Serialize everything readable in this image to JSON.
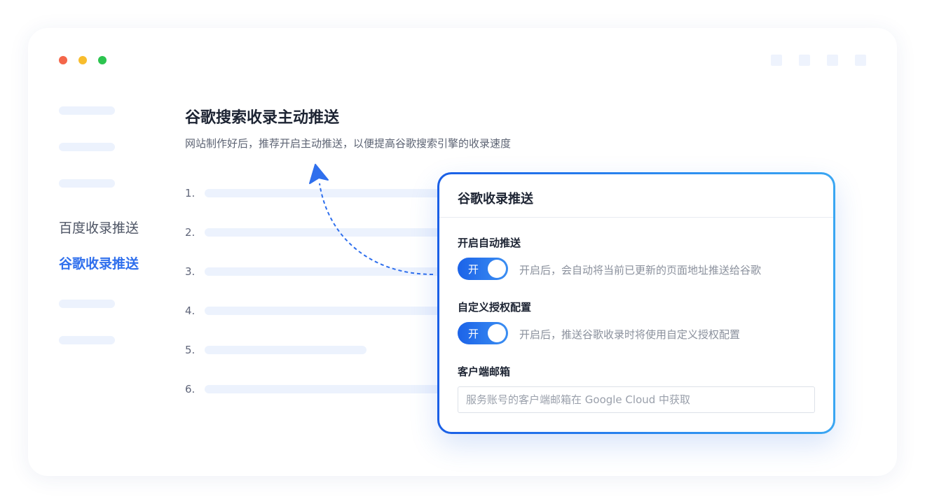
{
  "sidebar": {
    "items": [
      {
        "label": "百度收录推送",
        "active": false
      },
      {
        "label": "谷歌收录推送",
        "active": true
      }
    ]
  },
  "main": {
    "title": "谷歌搜索收录主动推送",
    "subtitle": "网站制作好后，推荐开启主动推送，以便提高谷歌搜索引擎的收录速度",
    "list_numbers": [
      "1.",
      "2.",
      "3.",
      "4.",
      "5.",
      "6."
    ]
  },
  "panel": {
    "title": "谷歌收录推送",
    "auto_push": {
      "label": "开启自动推送",
      "toggle_text": "开",
      "enabled": true,
      "description": "开启后，会自动将当前已更新的页面地址推送给谷歌"
    },
    "custom_auth": {
      "label": "自定义授权配置",
      "toggle_text": "开",
      "enabled": true,
      "description": "开启后，推送谷歌收录时将使用自定义授权配置"
    },
    "client_email": {
      "label": "客户端邮箱",
      "placeholder": "服务账号的客户端邮箱在 Google Cloud 中获取",
      "value": ""
    }
  },
  "colors": {
    "accent": "#2f6fed",
    "skeleton": "#ecf2fd",
    "dot_red": "#f4664a",
    "dot_yellow": "#f8bd2d",
    "dot_green": "#2cc44f"
  }
}
